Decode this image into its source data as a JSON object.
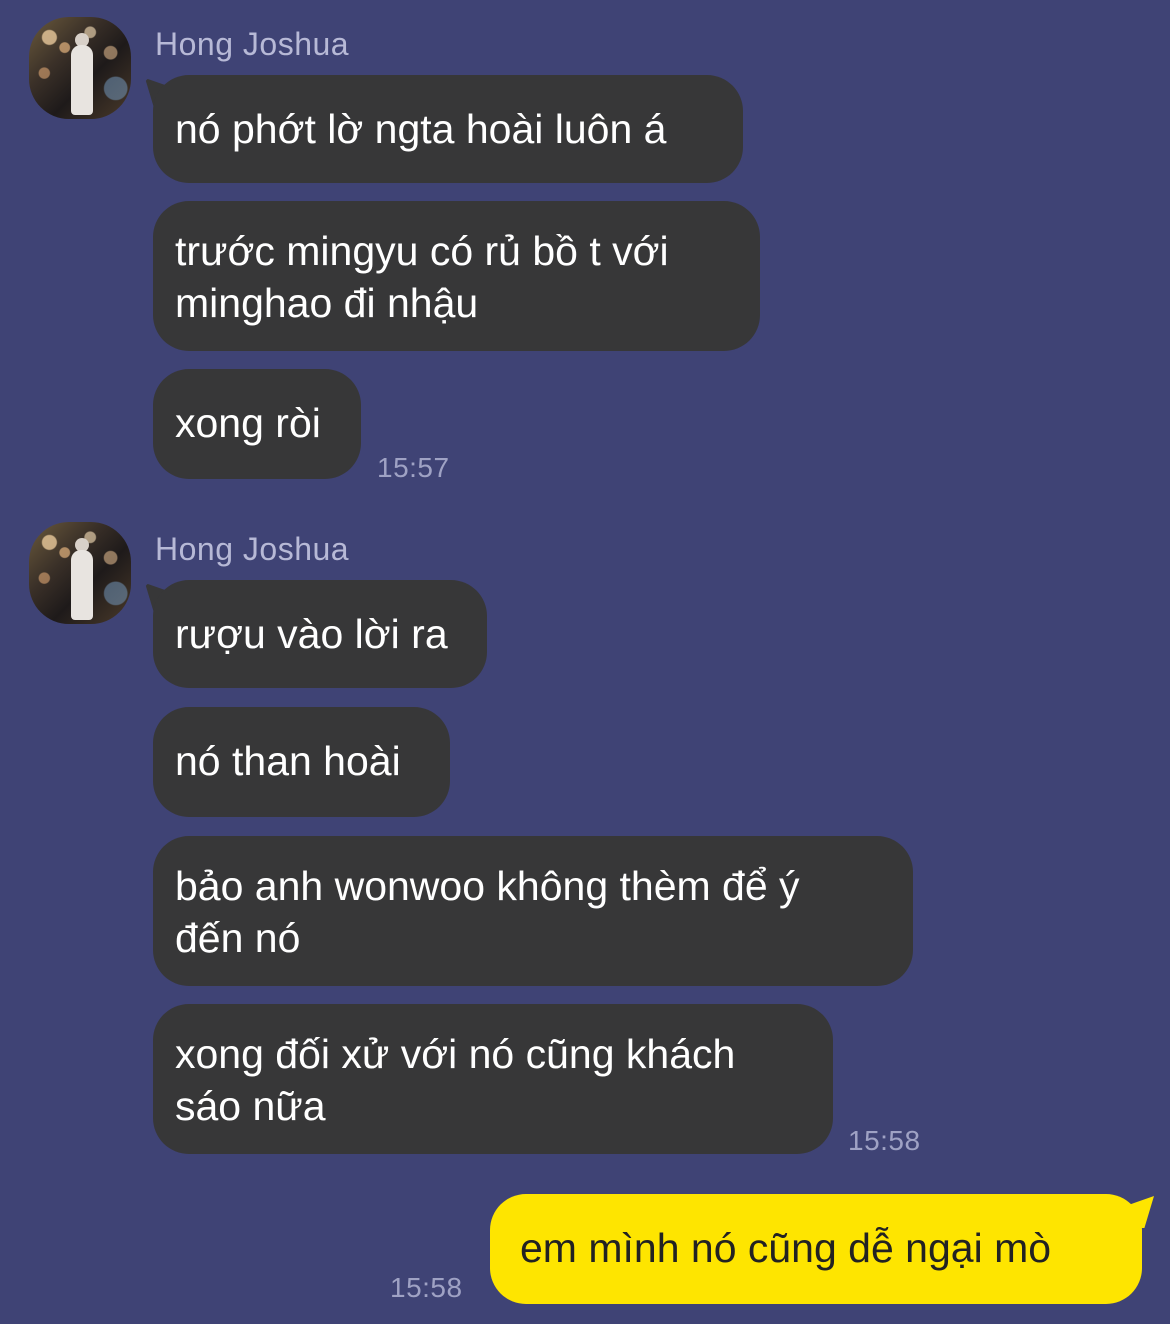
{
  "colors": {
    "background": "#3f4375",
    "incoming_bubble": "#373738",
    "outgoing_bubble": "#fee500",
    "sender_name": "#b7b9d6",
    "timestamp": "#9fa2c4"
  },
  "groups": [
    {
      "sender": "Hong Joshua",
      "avatar_icon": "profile-photo",
      "messages": [
        "nó phớt lờ ngta hoài luôn á",
        "trước mingyu có rủ bồ t với\nminghao đi nhậu",
        "xong ròi"
      ],
      "time": "15:57"
    },
    {
      "sender": "Hong Joshua",
      "avatar_icon": "profile-photo",
      "messages": [
        "rượu vào lời ra",
        "nó than hoài",
        "bảo anh wonwoo không thèm để ý\nđến nó",
        "xong đối xử với nó cũng khách\nsáo nữa"
      ],
      "time": "15:58"
    }
  ],
  "outgoing": {
    "message": "em mình nó cũng dễ ngại mò",
    "time": "15:58"
  }
}
